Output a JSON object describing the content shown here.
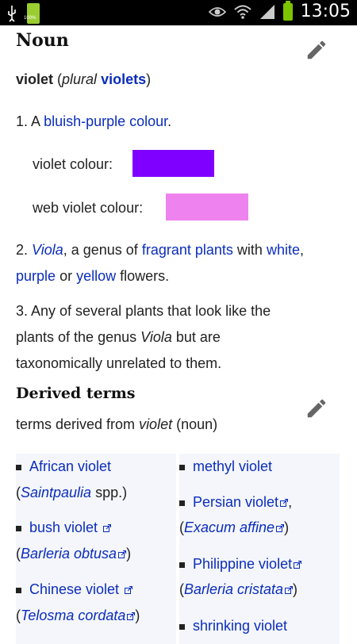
{
  "status_bar": {
    "battery_small_label": "100%",
    "time": "13:05"
  },
  "noun_section": {
    "heading": "Noun",
    "headword": "violet",
    "plural_prefix": "(",
    "plural_label": "plural",
    "plural_word": "violets",
    "plural_suffix": ")",
    "def1_num": "1. A",
    "def1_link": "bluish-purple colour",
    "def1_end": ".",
    "swatch1_label": "violet colour:",
    "swatch1_color": "#7f00ff",
    "swatch2_label": "web violet colour:",
    "swatch2_color": "#ee82ee",
    "def2_num": "2.",
    "def2_viola": "Viola",
    "def2_text1": ", a genus of",
    "def2_link1": "fragrant plants",
    "def2_text2": "with",
    "def2_link2": "white",
    "def2_comma": ",",
    "def2_link3": "purple",
    "def2_text3": "or",
    "def2_link4": "yellow",
    "def2_text4": "flowers.",
    "def3_line1": "3. Any of several plants that look like the",
    "def3_line2_a": "plants of the genus",
    "def3_line2_viola": "Viola",
    "def3_line2_b": "but are",
    "def3_line3": "taxonomically unrelated to them."
  },
  "derived_section": {
    "heading": "Derived terms",
    "intro_a": "terms derived from",
    "intro_word": "violet",
    "intro_b": "(noun)",
    "left_column": [
      {
        "term": "African violet",
        "paren_open": "(",
        "note_italic": "Saintpaulia",
        "note_rest": " spp.)"
      },
      {
        "term": "bush violet",
        "paren_open": "(",
        "note_italic": "Barleria obtusa",
        "note_rest": ")"
      },
      {
        "term": "Chinese violet",
        "paren_open": "(",
        "note_italic": "Telosma cordata",
        "note_rest": ")"
      }
    ],
    "right_column": [
      {
        "term": "methyl violet"
      },
      {
        "term": "Persian violet",
        "after": ",",
        "paren_open": "(",
        "note_italic": "Exacum affine",
        "note_rest": ")"
      },
      {
        "term": "Philippine violet",
        "paren_open": "(",
        "note_italic": "Barleria cristata",
        "note_rest": ")"
      },
      {
        "term": "shrinking violet"
      }
    ]
  },
  "colors": {
    "link": "#0b2dbb",
    "text": "#222222",
    "derived_bg": "#f4f6fb"
  }
}
